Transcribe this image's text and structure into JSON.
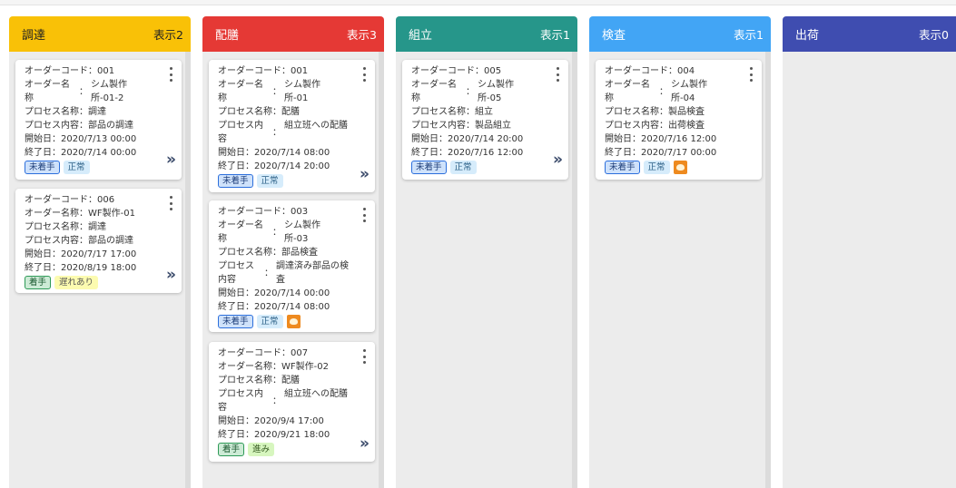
{
  "columns": [
    {
      "title": "調達",
      "count": "表示2",
      "color": "#f9c107",
      "text_color": "#222222"
    },
    {
      "title": "配膳",
      "count": "表示3",
      "color": "#e53935",
      "text_color": "#ffffff"
    },
    {
      "title": "組立",
      "count": "表示1",
      "color": "#26968a",
      "text_color": "#ffffff"
    },
    {
      "title": "検査",
      "count": "表示1",
      "color": "#42a5f5",
      "text_color": "#ffffff"
    },
    {
      "title": "出荷",
      "count": "表示0",
      "color": "#3f4db0",
      "text_color": "#ffffff"
    }
  ],
  "labels": {
    "order_code": "オーダーコード：",
    "order_name": "オーダー名称：",
    "order_name_split": "オーダー名称",
    "process_name": "プロセス名称：",
    "process_content": "プロセス内容：",
    "process_content_split": "プロセス内容",
    "colon": "：",
    "start": "開始日：",
    "end": "終了日："
  },
  "cards": {
    "c001": {
      "order_code": "001",
      "order_name": "シム製作所-01-2",
      "process_name": "調達",
      "process_content": "部品の調達",
      "start": "2020/7/13 00:00",
      "end": "2020/7/14 00:00",
      "status": "未着手",
      "state": "正常"
    },
    "c006": {
      "order_code": "006",
      "order_name": "WF製作-01",
      "process_name": "調達",
      "process_content": "部品の調達",
      "start": "2020/7/17 17:00",
      "end": "2020/8/19 18:00",
      "status": "着手",
      "state": "遅れあり"
    },
    "c001b": {
      "order_code": "001",
      "order_name": "シム製作所-01",
      "process_name": "配膳",
      "process_content": "組立班への配膳",
      "start": "2020/7/14 08:00",
      "end": "2020/7/14 20:00",
      "status": "未着手",
      "state": "正常"
    },
    "c003": {
      "order_code": "003",
      "order_name": "シム製作所-03",
      "process_name": "部品検査",
      "process_content": "調達済み部品の検査",
      "start": "2020/7/14 00:00",
      "end": "2020/7/14 08:00",
      "status": "未着手",
      "state": "正常"
    },
    "c007": {
      "order_code": "007",
      "order_name": "WF製作-02",
      "process_name": "配膳",
      "process_content": "組立班への配膳",
      "start": "2020/9/4 17:00",
      "end": "2020/9/21 18:00",
      "status": "着手",
      "state": "進み"
    },
    "c005": {
      "order_code": "005",
      "order_name": "シム製作所-05",
      "process_name": "組立",
      "process_content": "製品組立",
      "start": "2020/7/14 20:00",
      "end": "2020/7/16 12:00",
      "status": "未着手",
      "state": "正常"
    },
    "c004": {
      "order_code": "004",
      "order_name": "シム製作所-04",
      "process_name": "製品検査",
      "process_content": "出荷検査",
      "start": "2020/7/16 12:00",
      "end": "2020/7/17 00:00",
      "status": "未着手",
      "state": "正常"
    }
  },
  "icons": {
    "menu": "kebab-menu-icon",
    "next": "double-chevron-right-icon",
    "warning": "warning-icon"
  },
  "next_glyph": "»"
}
